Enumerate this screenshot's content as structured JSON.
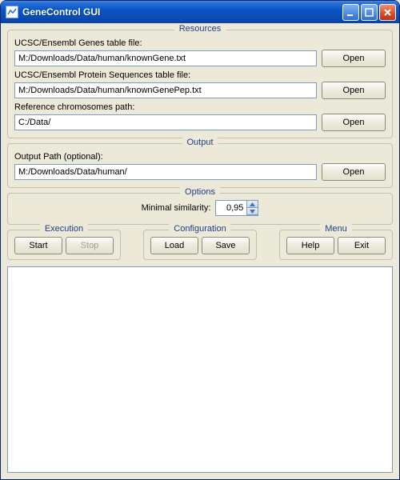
{
  "window": {
    "title": "GeneControl GUI"
  },
  "resources": {
    "legend": "Resources",
    "genesLabel": "UCSC/Ensembl Genes table file:",
    "genesValue": "M:/Downloads/Data/human/knownGene.txt",
    "proteinLabel": "UCSC/Ensembl Protein Sequences table file:",
    "proteinValue": "M:/Downloads/Data/human/knownGenePep.txt",
    "chromLabel": "Reference chromosomes path:",
    "chromValue": "C:/Data/",
    "openLabel": "Open"
  },
  "output": {
    "legend": "Output",
    "pathLabel": "Output Path (optional):",
    "pathValue": "M:/Downloads/Data/human/",
    "openLabel": "Open"
  },
  "options": {
    "legend": "Options",
    "minSimLabel": "Minimal similarity:",
    "minSimValue": "0,95"
  },
  "execution": {
    "legend": "Execution",
    "start": "Start",
    "stop": "Stop"
  },
  "configuration": {
    "legend": "Configuration",
    "load": "Load",
    "save": "Save"
  },
  "menu": {
    "legend": "Menu",
    "help": "Help",
    "exit": "Exit"
  }
}
